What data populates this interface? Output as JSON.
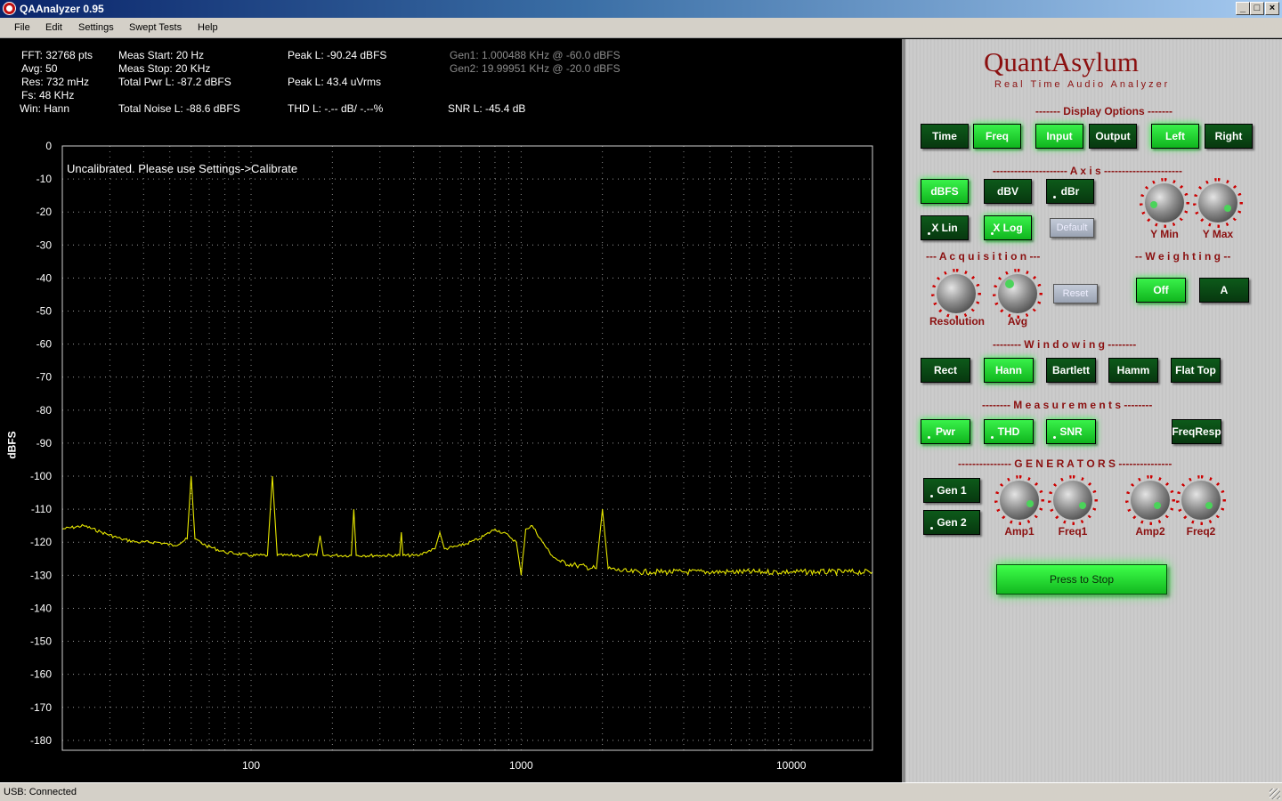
{
  "window": {
    "title": "QAAnalyzer 0.95",
    "minimize": "_",
    "maximize": "□",
    "close": "×"
  },
  "menu": [
    "File",
    "Edit",
    "Settings",
    "Swept Tests",
    "Help"
  ],
  "readout": {
    "fft": "FFT: 32768 pts",
    "avg": "Avg: 50",
    "res": "Res: 732 mHz",
    "fs": "Fs: 48 KHz",
    "win": "Win: Hann",
    "meas_start": "Meas Start: 20 Hz",
    "meas_stop": "Meas Stop: 20 KHz",
    "total_pwr": "Total Pwr L: -87.2 dBFS",
    "total_noise": "Total Noise L: -88.6 dBFS",
    "peak_dbfs": "Peak L: -90.24 dBFS",
    "peak_vrms": "Peak L: 43.4 uVrms",
    "thd": "THD L: -.-- dB/ -.--%",
    "gen1": "Gen1: 1.000488 KHz @ -60.0 dBFS",
    "gen2": "Gen2: 19.99951 KHz @ -20.0 dBFS",
    "snr": "SNR L: -45.4 dB"
  },
  "plot_message": "Uncalibrated. Please use Settings->Calibrate",
  "chart_data": {
    "type": "line",
    "title": "",
    "xlabel": "",
    "ylabel": "dBFS",
    "x_scale": "log",
    "xlim": [
      20,
      20000
    ],
    "ylim": [
      -183,
      0
    ],
    "x_ticks": [
      100,
      1000,
      10000
    ],
    "x_tick_labels": [
      "100",
      "1000",
      "10000"
    ],
    "y_ticks": [
      0,
      -10,
      -20,
      -30,
      -40,
      -50,
      -60,
      -70,
      -80,
      -90,
      -100,
      -110,
      -120,
      -130,
      -140,
      -150,
      -160,
      -170,
      -180
    ],
    "y_tick_labels": [
      "0",
      "-10",
      "-20",
      "-30",
      "-40",
      "-50",
      "-60",
      "-70",
      "-80",
      "-90",
      "-100",
      "-110",
      "-120",
      "-130",
      "-140",
      "-150",
      "-160",
      "-170",
      "-180"
    ],
    "grid": true,
    "line_color": "#e8e800",
    "series": [
      {
        "x": [
          20,
          24,
          28,
          33,
          38,
          45,
          52,
          58,
          60,
          62,
          68,
          80,
          100,
          115,
          120,
          125,
          150,
          175,
          180,
          185,
          200,
          235,
          240,
          245,
          260,
          300,
          355,
          360,
          365,
          400,
          420,
          440,
          480,
          500,
          520,
          600,
          700,
          800,
          900,
          960,
          1000,
          1040,
          1100,
          1200,
          1300,
          1400,
          1600,
          1900,
          2000,
          2100,
          2500,
          3000,
          4000,
          6000,
          8000,
          10000,
          14000,
          20000
        ],
        "y": [
          -116,
          -115,
          -117,
          -119,
          -120,
          -120,
          -121,
          -119,
          -100,
          -119,
          -121,
          -123,
          -124,
          -124,
          -100,
          -124,
          -124,
          -124,
          -118,
          -124,
          -124,
          -124,
          -110,
          -124,
          -124,
          -124,
          -124,
          -117,
          -124,
          -124,
          -124,
          -123,
          -122,
          -117,
          -122,
          -121,
          -119,
          -116,
          -118,
          -120,
          -130,
          -116,
          -115,
          -120,
          -124,
          -126,
          -127,
          -128,
          -110,
          -128,
          -129,
          -129,
          -129,
          -129,
          -129,
          -129,
          -129,
          -129
        ]
      }
    ]
  },
  "panel": {
    "brand": "QuantAsylum",
    "tagline": "Real Time Audio Analyzer",
    "display_options_title": "------- Display Options -------",
    "display_buttons": [
      "Time",
      "Freq",
      "Input",
      "Output",
      "Left",
      "Right"
    ],
    "axis_title": "--------------------- A x i s ----------------------",
    "axis_buttons": [
      "dBFS",
      "dBV",
      "dBr"
    ],
    "xscale_buttons": [
      "X Lin",
      "X Log",
      "Default"
    ],
    "ymin_label": "Y Min",
    "ymax_label": "Y Max",
    "acquisition_title": "--- A c q u i s i t i o n ---",
    "resolution_label": "Resolution",
    "avg_label": "Avg",
    "reset_button": "Reset",
    "weighting_title": "-- W e i g h t i n g --",
    "weighting_buttons": [
      "Off",
      "A"
    ],
    "windowing_title": "-------- W i n d o w i n g --------",
    "window_buttons": [
      "Rect",
      "Hann",
      "Bartlett",
      "Hamm",
      "Flat Top"
    ],
    "measurements_title": "-------- M e a s u r e m e n t s --------",
    "measure_buttons": [
      "Pwr",
      "THD",
      "SNR",
      "FreqResp"
    ],
    "generators_title": "--------------- G E N E R A T O R S ---------------",
    "gen_buttons": [
      "Gen 1",
      "Gen 2"
    ],
    "gen_knobs": [
      "Amp1",
      "Freq1",
      "Amp2",
      "Freq2"
    ],
    "stop_button": "Press to Stop"
  },
  "status": {
    "text": "USB: Connected"
  },
  "colors": {
    "accent": "#8b1010",
    "btn_on": "#21ff3a",
    "btn_off": "#0d5a1a",
    "trace": "#e8e800"
  }
}
